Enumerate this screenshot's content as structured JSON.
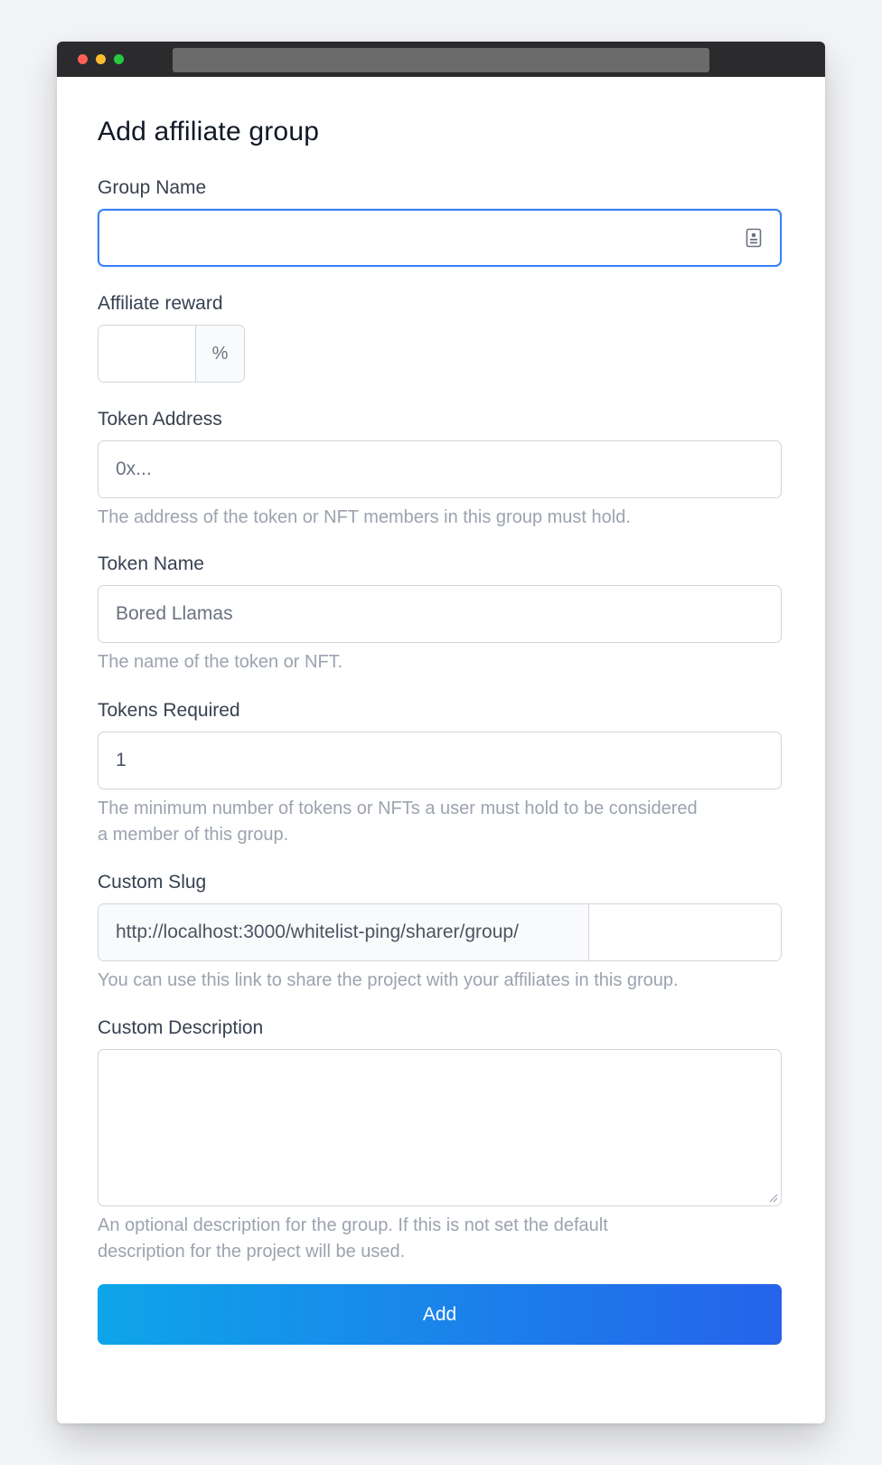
{
  "window": {
    "traffic_lights": [
      "#ff5f57",
      "#febc2e",
      "#28c840"
    ]
  },
  "form": {
    "title": "Add affiliate group",
    "group_name": {
      "label": "Group Name",
      "value": "",
      "icon": "contact-card-icon"
    },
    "affiliate_reward": {
      "label": "Affiliate reward",
      "value": "",
      "suffix": "%"
    },
    "token_address": {
      "label": "Token Address",
      "placeholder": "0x...",
      "help": "The address of the token or NFT members in this group must hold."
    },
    "token_name": {
      "label": "Token Name",
      "placeholder": "Bored Llamas",
      "help": "The name of the token or NFT."
    },
    "tokens_required": {
      "label": "Tokens Required",
      "value": "1",
      "help_line1": "The minimum number of tokens or NFTs a user must hold to be considered",
      "help_line2": "a member of this group."
    },
    "custom_slug": {
      "label": "Custom Slug",
      "prefix": "http://localhost:3000/whitelist-ping/sharer/group/",
      "value": "",
      "help": "You can use this link to share the project with your affiliates in this group."
    },
    "custom_description": {
      "label": "Custom Description",
      "value": "",
      "help_line1": "An optional description for the group. If this is not set the default",
      "help_line2": "description for the project will be used."
    },
    "submit_label": "Add"
  },
  "colors": {
    "accent_start": "#0ea5e9",
    "accent_end": "#2563eb",
    "focus_border": "#3b82f6"
  }
}
